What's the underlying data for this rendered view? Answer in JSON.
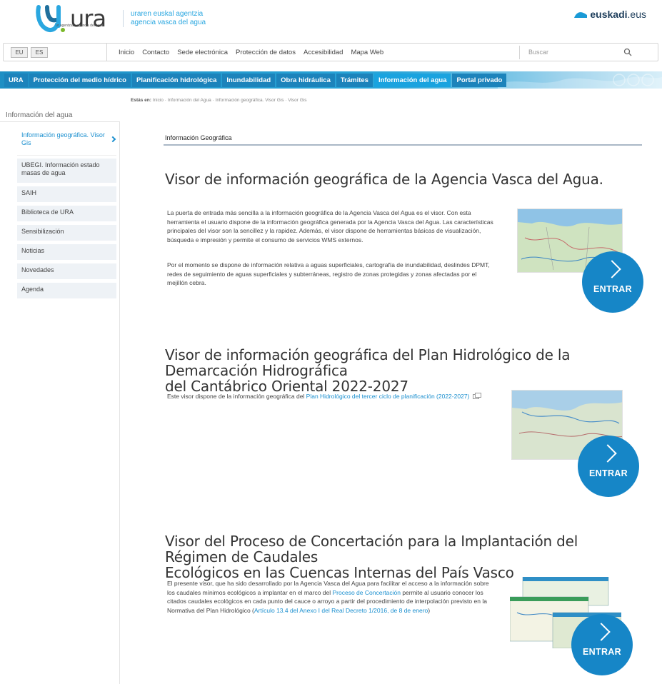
{
  "header": {
    "logo_text": "ura",
    "logo_sub": "ur agentzia · agencia del agua",
    "agency_line1": "uraren euskal agentzia",
    "agency_line2": "agencia vasca del agua",
    "euskadi_bold": "euskadi",
    "euskadi_light": ".eus"
  },
  "utility": {
    "lang_eu": "EU",
    "lang_es": "ES",
    "links": [
      "Inicio",
      "Contacto",
      "Sede electrónica",
      "Protección de datos",
      "Accesibilidad",
      "Mapa Web"
    ],
    "search_placeholder": "Buscar"
  },
  "nav": {
    "items": [
      "URA",
      "Protección del medio hídrico",
      "Planificación hidrológica",
      "Inundabilidad",
      "Obra hidráulica",
      "Trámites",
      "Información del agua",
      "Portal privado"
    ],
    "active_index": 6
  },
  "breadcrumb": {
    "prefix": "Estás en:",
    "path": "Inicio · Información del Agua · Información geográfica. Visor Gis · Visor Gis"
  },
  "sidebar": {
    "title": "Información del agua",
    "items": [
      "Información geográfica. Visor Gis",
      "UBEGI. Información estado masas de agua",
      "SAIH",
      "Biblioteca de URA",
      "Sensibilización",
      "Noticias",
      "Novedades",
      "Agenda"
    ]
  },
  "content": {
    "section_label": "Información Geográfica",
    "blocks": [
      {
        "title": "Visor de información geográfica de la Agencia Vasca del Agua.",
        "p1": "La puerta de entrada más sencilla a la información geográfica de la Agencia Vasca del Agua es el visor. Con esta herramienta el usuario dispone de la información geográfica generada por la Agencia Vasca del Agua. Las características principales del visor son la sencillez y la rapidez. Además, el visor dispone de herramientas básicas de visualización, búsqueda e impresión y permite el consumo de servicios WMS externos.",
        "p2": "Por el momento se dispone de información relativa a aguas superficiales, cartografía de inundabilidad, deslindes DPMT, redes de seguimiento de aguas superficiales y subterráneas, registro de zonas protegidas y zonas afectadas por el mejillón cebra.",
        "button": "ENTRAR"
      },
      {
        "title_line1": "Visor de información geográfica del Plan Hidrológico de la Demarcación Hidrográfica",
        "title_line2": "del Cantábrico Oriental 2022-2027",
        "text_before": "Este visor dispone de la información geográfica del ",
        "link": "Plan Hidrológico del tercer ciclo de planificación (2022-2027)",
        "button": "ENTRAR"
      },
      {
        "title_line1": "Visor del Proceso de Concertación para la Implantación del Régimen de Caudales",
        "title_line2": "Ecológicos en las Cuencas Internas del País Vasco",
        "text1": "El presente visor, que ha sido desarrollado por la Agencia Vasca del Agua para facilitar el acceso a la información sobre los caudales mínimos ecológicos a implantar en el marco del ",
        "link1": "Proceso de Concertación",
        "text2": " permite al usuario conocer los citados caudales ecológicos en cada punto del cauce o arroyo a partir del procedimiento de interpolación previsto en la Normativa del Plan Hidrológico (",
        "link2": "Artículo 13.4 del Anexo I del Real Decreto 1/2016, de 8 de enero",
        "text3": ")",
        "button": "ENTRAR"
      }
    ]
  },
  "colors": {
    "brand_blue": "#1686c7",
    "nav_blue": "#1c83bb",
    "nav_active": "#1aa3df",
    "link": "#1a8fcf"
  },
  "icons": [
    "ura-logo-icon",
    "euskadi-logo-icon",
    "search-icon",
    "chevron-right-icon",
    "external-link-icon"
  ]
}
